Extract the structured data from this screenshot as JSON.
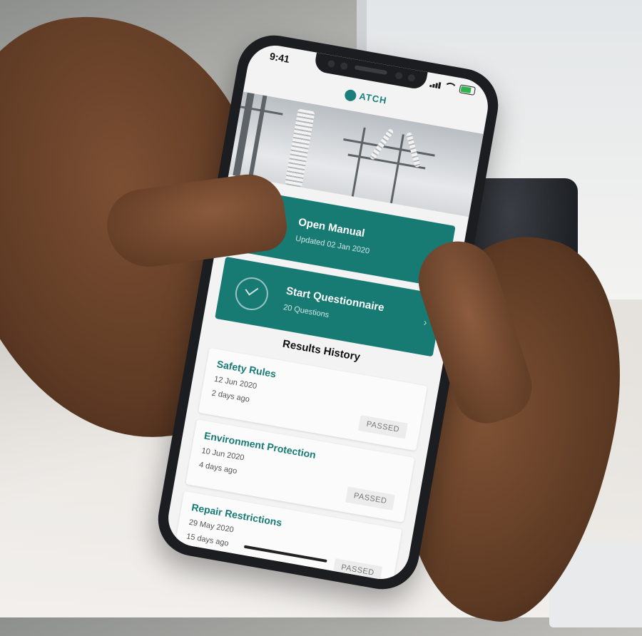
{
  "status_bar": {
    "time": "9:41",
    "signal_icon": "signal-icon",
    "wifi_icon": "wifi-icon",
    "battery_icon": "battery-icon",
    "battery_color": "#2eb34a"
  },
  "app": {
    "logo_text": "ATCH",
    "accent_color": "#177b74"
  },
  "hero": {
    "image": "power-substation-photo"
  },
  "actions": [
    {
      "title": "Open Manual",
      "subtitle": "Updated 02 Jan 2020",
      "icon": "document-icon"
    },
    {
      "title": "Start Questionnaire",
      "subtitle": "20 Questions",
      "icon": "checkmark-circle-icon"
    }
  ],
  "results": {
    "heading": "Results History",
    "items": [
      {
        "title": "Safety Rules",
        "date": "12 Jun 2020",
        "ago": "2 days ago",
        "status": "PASSED"
      },
      {
        "title": "Environment Protection",
        "date": "10 Jun 2020",
        "ago": "4 days ago",
        "status": "PASSED"
      },
      {
        "title": "Repair Restrictions",
        "date": "29 May 2020",
        "ago": "15 days ago",
        "status": "PASSED"
      }
    ]
  }
}
